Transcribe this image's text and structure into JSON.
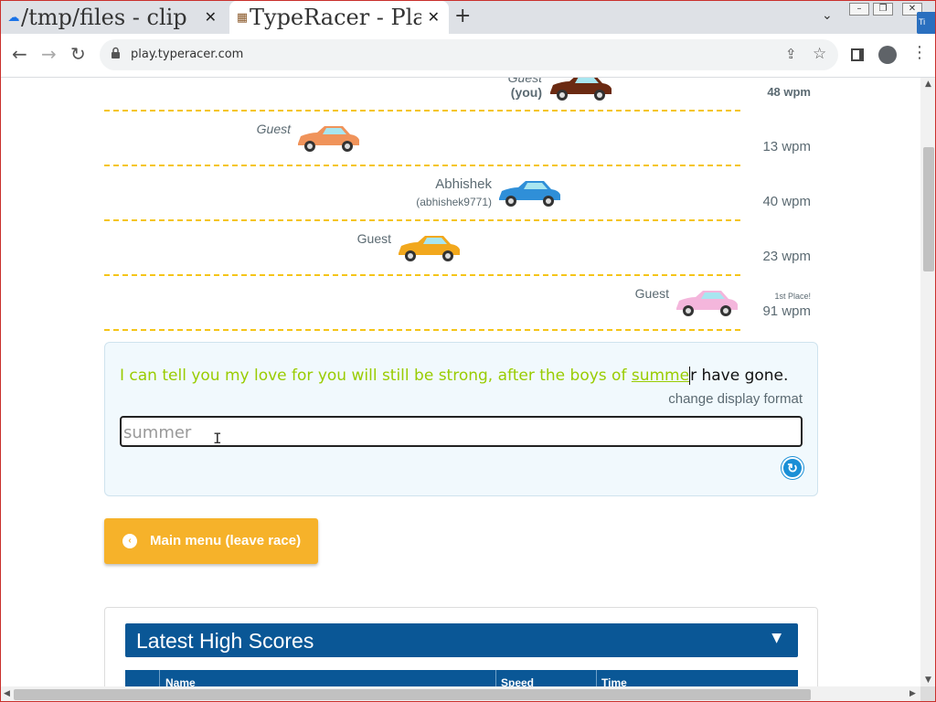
{
  "browser": {
    "tabs": [
      {
        "title": "/tmp/files - clip",
        "icon": "cloud-icon",
        "close": "✕"
      },
      {
        "title": "TypeRacer - Play",
        "icon": "typeracer-favicon",
        "close": "✕"
      }
    ],
    "new_tab": "+",
    "tab_search": "⌄",
    "window_min": "–",
    "window_max": "❐",
    "window_close": "✕",
    "edge_label": "Ti",
    "url": "play.typeracer.com",
    "back": "←",
    "forward": "→",
    "reload": "↻",
    "share": "⇪",
    "bookmark": "☆",
    "menu": "⋮"
  },
  "race": {
    "racers": [
      {
        "name": "Guest",
        "sub": "(you)",
        "wpm": "48 wpm",
        "place": "",
        "car_color": "#6b2a12"
      },
      {
        "name": "Guest",
        "sub": "",
        "wpm": "13 wpm",
        "place": "",
        "car_color": "#f0935a"
      },
      {
        "name": "Abhishek",
        "sub": "(abhishek9771)",
        "wpm": "40 wpm",
        "place": "",
        "car_color": "#2f8fd8"
      },
      {
        "name": "Guest",
        "sub": "",
        "wpm": "23 wpm",
        "place": "",
        "car_color": "#f2a81d"
      },
      {
        "name": "Guest",
        "sub": "",
        "wpm": "91 wpm",
        "place": "1st Place!",
        "car_color": "#f4b6dc"
      }
    ],
    "quote": {
      "typed": "I can tell you my love for you will still be strong, after the boys of ",
      "current_typed": "summe",
      "cursor_char": "r",
      "rest": " have gone."
    },
    "change_display_format": "change display format",
    "input_value": "summer",
    "help_glyph": "↻",
    "colors": {
      "typed": "#99cc00",
      "lane": "#f5c518",
      "accent": "#0a5796",
      "button": "#f6b22a"
    }
  },
  "main_menu": {
    "label": "Main menu (leave race)",
    "icon": "‹"
  },
  "high_scores": {
    "title": "Latest High Scores",
    "caret": "▼",
    "columns": [
      "",
      "Name",
      "Speed",
      "Time"
    ]
  }
}
